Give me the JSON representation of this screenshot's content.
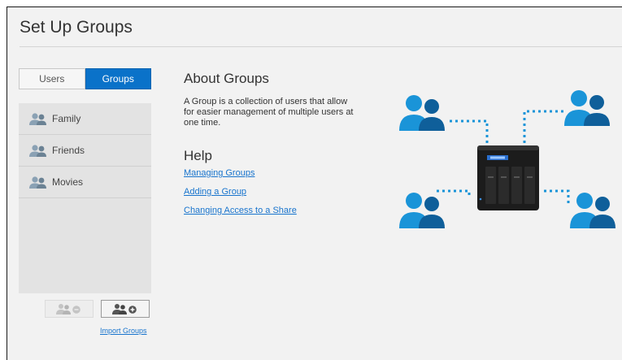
{
  "page": {
    "title": "Set Up Groups"
  },
  "tabs": [
    {
      "label": "Users"
    },
    {
      "label": "Groups"
    }
  ],
  "groups": [
    {
      "name": "Family"
    },
    {
      "name": "Friends"
    },
    {
      "name": "Movies"
    }
  ],
  "actions": {
    "import_label": "Import Groups"
  },
  "about": {
    "heading": "About Groups",
    "text": "A Group is a collection of users that allow for easier management of multiple users at one time."
  },
  "help": {
    "heading": "Help",
    "links": [
      "Managing Groups",
      "Adding a Group",
      "Changing Access to a Share"
    ]
  },
  "colors": {
    "accent": "#0a72c9",
    "illustration_blue": "#1a94d8",
    "link": "#1874cd"
  }
}
